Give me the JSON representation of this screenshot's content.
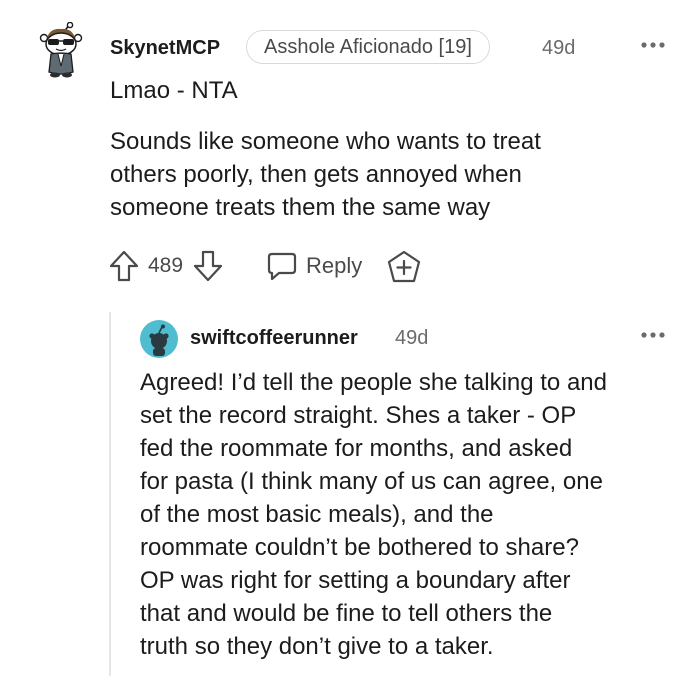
{
  "comment": {
    "username": "SkynetMCP",
    "flair": "Asshole Aficionado [19]",
    "timestamp": "49d",
    "headline": "Lmao - NTA",
    "body_lines": [
      "Sounds like someone who wants to treat",
      "others poorly, then gets annoyed when",
      "someone treats them the same way"
    ],
    "score": "489",
    "reply_label": "Reply",
    "icons": {
      "avatar": "snoo-sunglasses-avatar",
      "more": "more-options-icon",
      "upvote": "upvote-arrow-icon",
      "downvote": "downvote-arrow-icon",
      "reply": "speech-bubble-icon",
      "award": "award-plus-icon"
    }
  },
  "reply": {
    "username": "swiftcoffeerunner",
    "timestamp": "49d",
    "body_lines": [
      "Agreed! I’d tell the people she talking to and",
      "set the record straight. Shes a taker - OP",
      "fed the roommate for months, and asked",
      "for pasta (I think many of us can agree, one",
      "of the most basic meals), and the",
      "roommate couldn’t be bothered to share?",
      "OP was right for setting a boundary after",
      "that and would be fine to tell others the",
      "truth so they don’t give to a taker."
    ],
    "icons": {
      "avatar": "default-snoo-avatar",
      "more": "more-options-icon"
    }
  },
  "colors": {
    "text": "#1c1c1c",
    "muted": "#6b6b6b",
    "avatar_teal": "#4fbcd0",
    "thread_line": "#e4e6e8"
  }
}
